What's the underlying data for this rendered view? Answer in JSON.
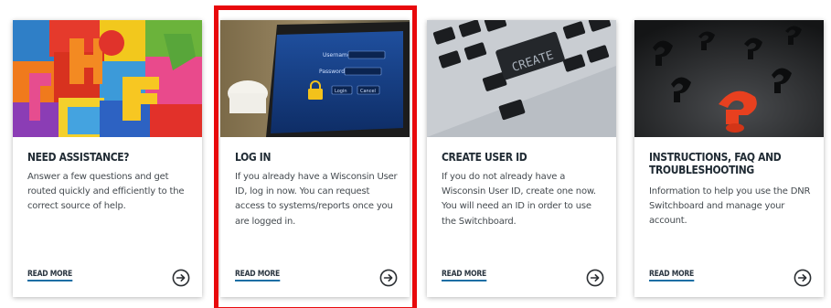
{
  "cards": [
    {
      "title": "NEED ASSISTANCE?",
      "description": "Answer a few questions and get routed quickly and efficiently to the correct source of help.",
      "read_more": "READ MORE",
      "image": "colorful-letter-blocks"
    },
    {
      "title": "LOG IN",
      "description": "If you already have a Wisconsin User ID, log in now. You can request access to systems/reports once you are logged in.",
      "read_more": "READ MORE",
      "image": "tablet-login-screen"
    },
    {
      "title": "CREATE USER ID",
      "description": "If you do not already have a Wisconsin User ID, create one now. You will need an ID in order to use the Switchboard.",
      "read_more": "READ MORE",
      "image": "keyboard-create-key"
    },
    {
      "title": "INSTRUCTIONS, FAQ AND\nTROUBLESHOOTING",
      "description": "Information to help you use the DNR Switchboard and manage your account.",
      "read_more": "READ MORE",
      "image": "red-question-mark"
    }
  ],
  "image_text": {
    "username": "Username",
    "password": "Password",
    "login": "Login",
    "cancel": "Cancel",
    "create": "CREATE"
  },
  "colors": {
    "highlight": "#e8090c",
    "title": "#202b34",
    "link_underline": "#1d6fa5"
  }
}
